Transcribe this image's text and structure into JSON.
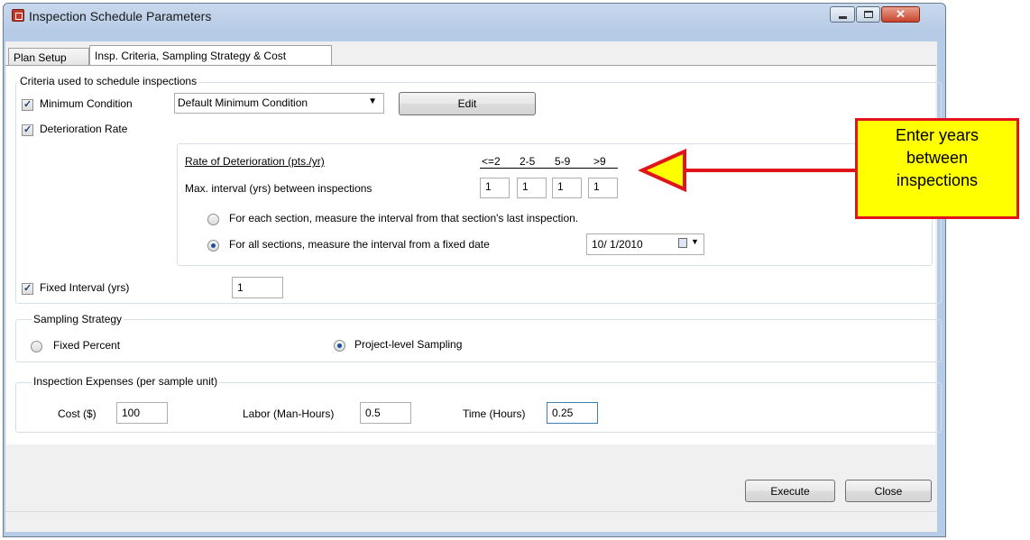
{
  "window": {
    "title": "Inspection Schedule Parameters"
  },
  "tabs": [
    {
      "label": "Plan Setup"
    },
    {
      "label": "Insp. Criteria, Sampling Strategy & Cost"
    }
  ],
  "criteria": {
    "group_label": "Criteria used to schedule inspections",
    "min_condition": {
      "label": "Minimum Condition",
      "checked": true,
      "selected": "Default Minimum Condition",
      "edit_label": "Edit"
    },
    "deterioration": {
      "label": "Deterioration Rate",
      "checked": true,
      "rate_label": "Rate of Deterioration (pts./yr)",
      "max_interval_label": "Max. interval (yrs) between inspections",
      "columns": [
        "<=2",
        "2-5",
        "5-9",
        ">9"
      ],
      "intervals": [
        "1",
        "1",
        "1",
        "1"
      ],
      "radio_each": "For each section, measure the interval from that section's last inspection.",
      "radio_fixed": "For all sections, measure the interval from a fixed date",
      "fixed_date": "10/  1/2010"
    },
    "fixed_interval": {
      "label": "Fixed Interval (yrs)",
      "checked": true,
      "value": "1"
    }
  },
  "sampling": {
    "group_label": "Sampling Strategy",
    "fixed_percent": "Fixed Percent",
    "project_level": "Project-level Sampling",
    "selected": "project_level"
  },
  "expenses": {
    "group_label": "Inspection Expenses (per sample unit)",
    "cost_label": "Cost ($)",
    "cost": "100",
    "labor_label": "Labor (Man-Hours)",
    "labor": "0.5",
    "time_label": "Time (Hours)",
    "time": "0.25"
  },
  "buttons": {
    "execute": "Execute",
    "close": "Close"
  },
  "callout": {
    "line1": "Enter years",
    "line2": "between",
    "line3": "inspections"
  },
  "colors": {
    "callout_fill": "#ffff00",
    "callout_border": "#e0141b",
    "arrow": "#e0141b"
  }
}
